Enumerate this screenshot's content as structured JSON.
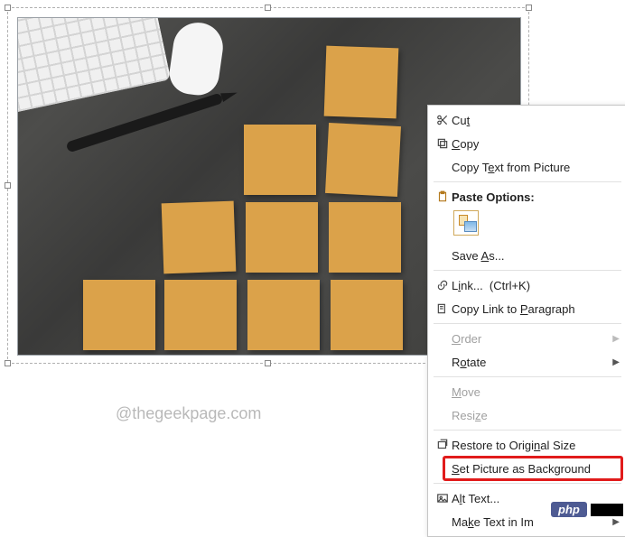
{
  "watermark": "@thegeekpage.com",
  "menu": {
    "cut": "Cut",
    "copy": "Copy",
    "copy_text_from_picture": "Copy Text from Picture",
    "paste_options": "Paste Options:",
    "save_as": "Save As...",
    "link": "Link...  (Ctrl+K)",
    "copy_link_to_paragraph": "Copy Link to Paragraph",
    "order": "Order",
    "rotate": "Rotate",
    "move": "Move",
    "resize": "Resize",
    "restore_original": "Restore to Original Size",
    "set_picture_bg": "Set Picture as Background",
    "alt_text": "Alt Text...",
    "make_text_in_image": "Make Text in Im"
  },
  "badge": {
    "php": "php"
  }
}
